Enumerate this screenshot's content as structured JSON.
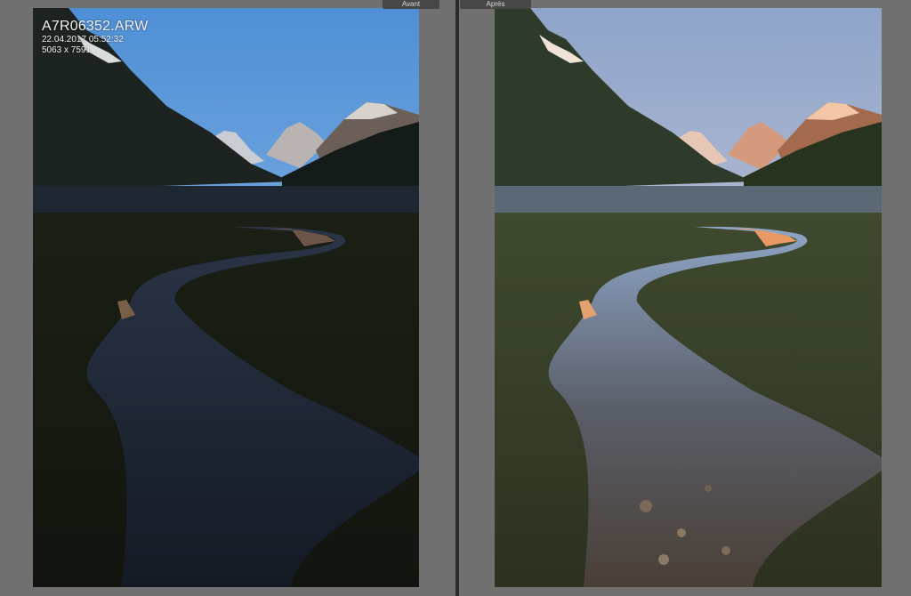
{
  "compare": {
    "before_label": "Avant",
    "after_label": "Après"
  },
  "photo_info": {
    "filename": "A7R06352.ARW",
    "datetime": "22.04.2017 05:52:32",
    "dimensions": "5063 x 7591"
  },
  "colors": {
    "panel_background": "#707070",
    "divider": "#2a2a2a",
    "tab_background": "#474747"
  }
}
